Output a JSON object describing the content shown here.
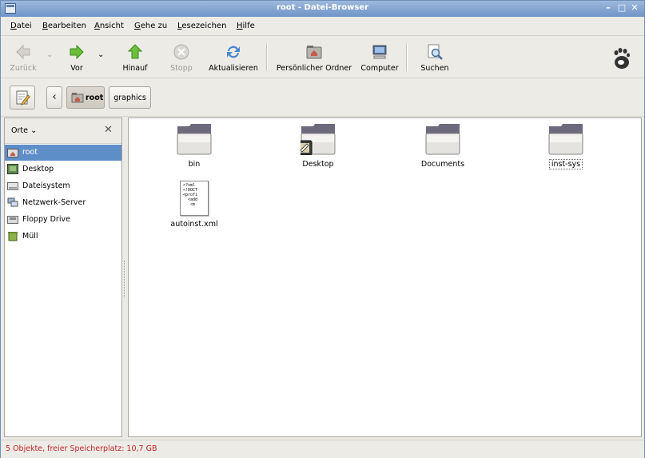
{
  "window": {
    "title": "root - Datei-Browser"
  },
  "menu": [
    {
      "label": "Datei"
    },
    {
      "label": "Bearbeiten"
    },
    {
      "label": "Ansicht"
    },
    {
      "label": "Gehe zu"
    },
    {
      "label": "Lesezeichen"
    },
    {
      "label": "Hilfe"
    }
  ],
  "toolbar": {
    "back": "Zurück",
    "forward": "Vor",
    "up": "Hinauf",
    "stop": "Stopp",
    "reload": "Aktualisieren",
    "home": "Persönlicher Ordner",
    "computer": "Computer",
    "search": "Suchen"
  },
  "location": {
    "back_glyph": "‹",
    "crumbs": [
      {
        "label": "root",
        "active": true
      },
      {
        "label": "graphics",
        "active": false
      }
    ]
  },
  "sidebar": {
    "header": "Orte",
    "items": [
      {
        "label": "root",
        "icon": "home-folder-icon",
        "selected": true
      },
      {
        "label": "Desktop",
        "icon": "desktop-icon",
        "selected": false
      },
      {
        "label": "Dateisystem",
        "icon": "drive-icon",
        "selected": false
      },
      {
        "label": "Netzwerk-Server",
        "icon": "network-icon",
        "selected": false
      },
      {
        "label": "Floppy Drive",
        "icon": "floppy-icon",
        "selected": false
      },
      {
        "label": "Müll",
        "icon": "trash-icon",
        "selected": false
      }
    ]
  },
  "files": [
    {
      "name": "bin",
      "type": "folder"
    },
    {
      "name": "Desktop",
      "type": "folder-desktop"
    },
    {
      "name": "Documents",
      "type": "folder"
    },
    {
      "name": "inst-sys",
      "type": "folder"
    },
    {
      "name": "autoinst.xml",
      "type": "xml",
      "preview": "<?xml\n<!DOCT\n<profi\n  <add\n   <m"
    }
  ],
  "status": "5 Objekte, freier Speicherplatz: 10,7 GB",
  "colors": {
    "selection": "#5e8ec8",
    "status_text": "#c0262c",
    "titlebar": "#7095c7"
  }
}
